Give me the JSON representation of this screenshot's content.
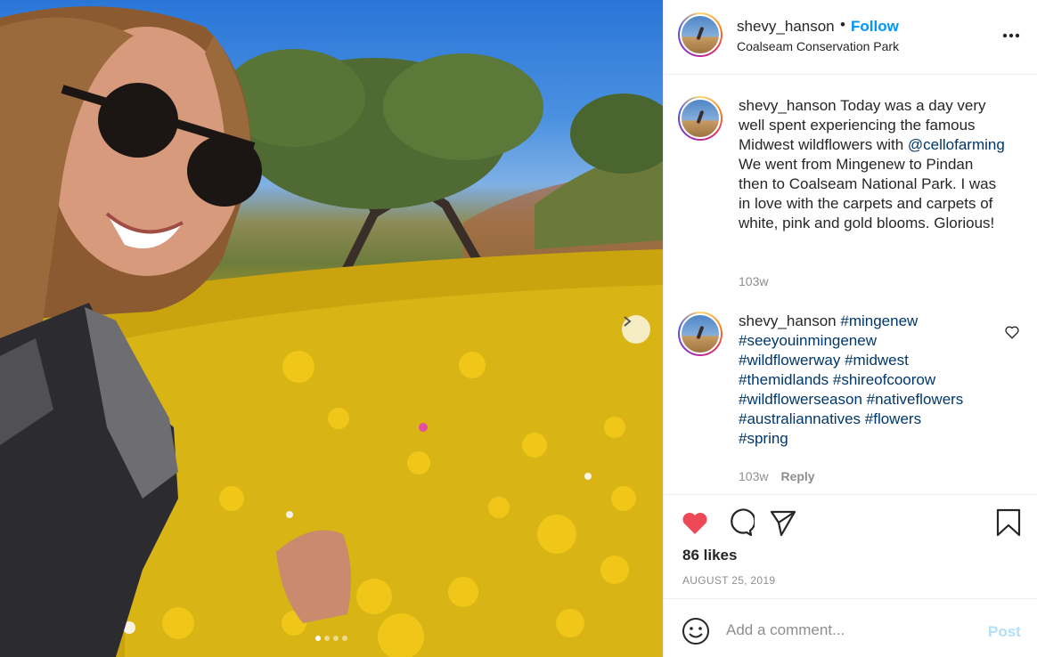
{
  "post": {
    "username": "shevy_hanson",
    "follow_label": "Follow",
    "bullet": "•",
    "location": "Coalseam Conservation Park"
  },
  "caption": {
    "username": "shevy_hanson",
    "text_1": "Today was a day very well spent experiencing the famous Midwest wildflowers with",
    "mention": "@cellofarming",
    "text_2": "We went from Mingenew to Pindan then to Coalseam National Park. I was in love with the carpets and carpets of white, pink and gold blooms. Glorious!",
    "time": "103w"
  },
  "hashtag_comment": {
    "username": "shevy_hanson",
    "tags": [
      "#mingenew",
      "#seeyouinmingenew",
      "#wildflowerway",
      "#midwest",
      "#themidlands",
      "#shireofcoorow",
      "#wildflowerseason",
      "#nativeflowers",
      "#australiannatives",
      "#flowers",
      "#spring"
    ],
    "time": "103w",
    "reply_label": "Reply"
  },
  "actions": {
    "likes": "86 likes",
    "date": "AUGUST 25, 2019"
  },
  "comment_box": {
    "placeholder": "Add a comment...",
    "post_label": "Post"
  },
  "carousel": {
    "slide_count": 4,
    "active_index": 0
  },
  "colors": {
    "accent": "#0095f6",
    "like_red": "#ed4956",
    "link": "#00376b",
    "muted": "#8e8e8e",
    "post_disabled": "#b2dffc"
  }
}
